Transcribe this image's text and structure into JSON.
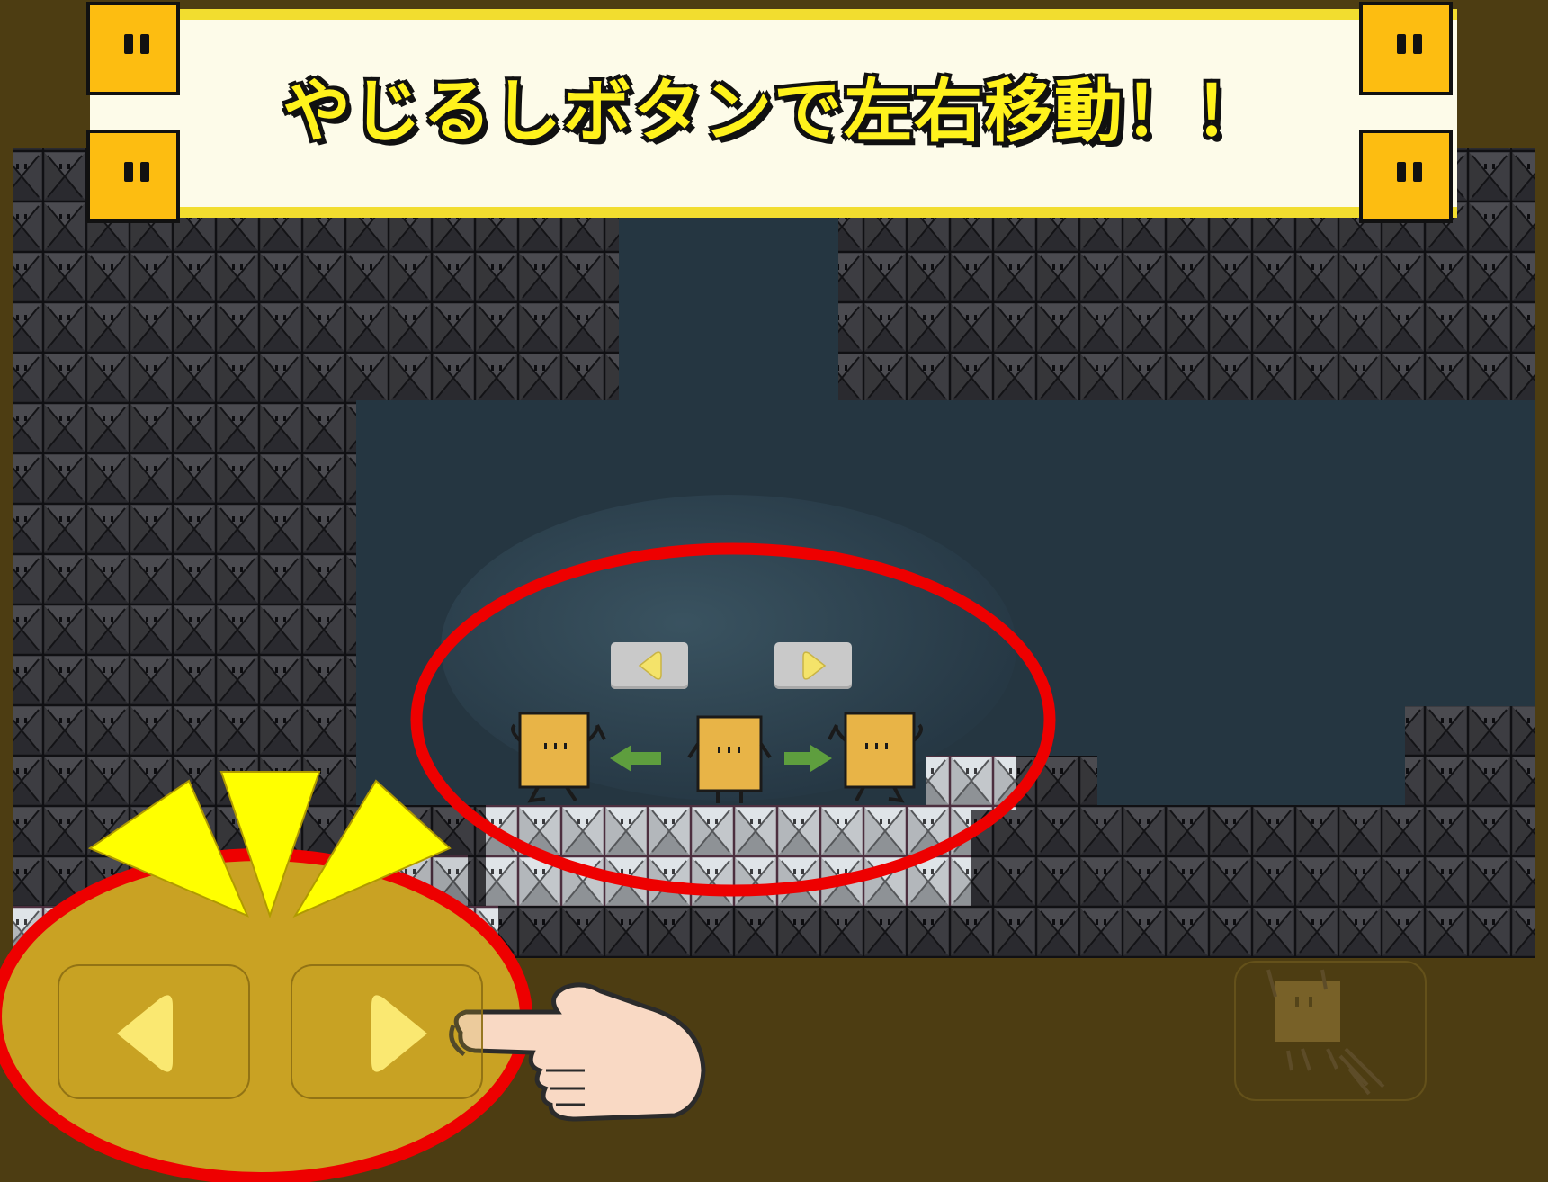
{
  "title_banner": {
    "text": "やじるしボタンで左右移動！！"
  },
  "colors": {
    "background": "#4d3d12",
    "banner_border": "#f2dd2f",
    "banner_fill": "#fdfbe9",
    "title_text": "#fff21c",
    "highlight_ring": "#ee0000",
    "spark": "#ffff00",
    "character": "#e8b447",
    "move_arrow": "#5e9e3e",
    "control_fill": "#c9a223",
    "button_glyph": "#fae871"
  },
  "icons": {
    "left_button": "triangle-left-icon",
    "right_button": "triangle-right-icon",
    "jump_button": "jumping-square-icon",
    "pointer": "pointing-hand-icon",
    "banner_corners": "square-face-icon"
  },
  "demo": {
    "characters": [
      "moved-left",
      "standing",
      "moved-right"
    ],
    "move_arrows": [
      "left",
      "right"
    ]
  }
}
